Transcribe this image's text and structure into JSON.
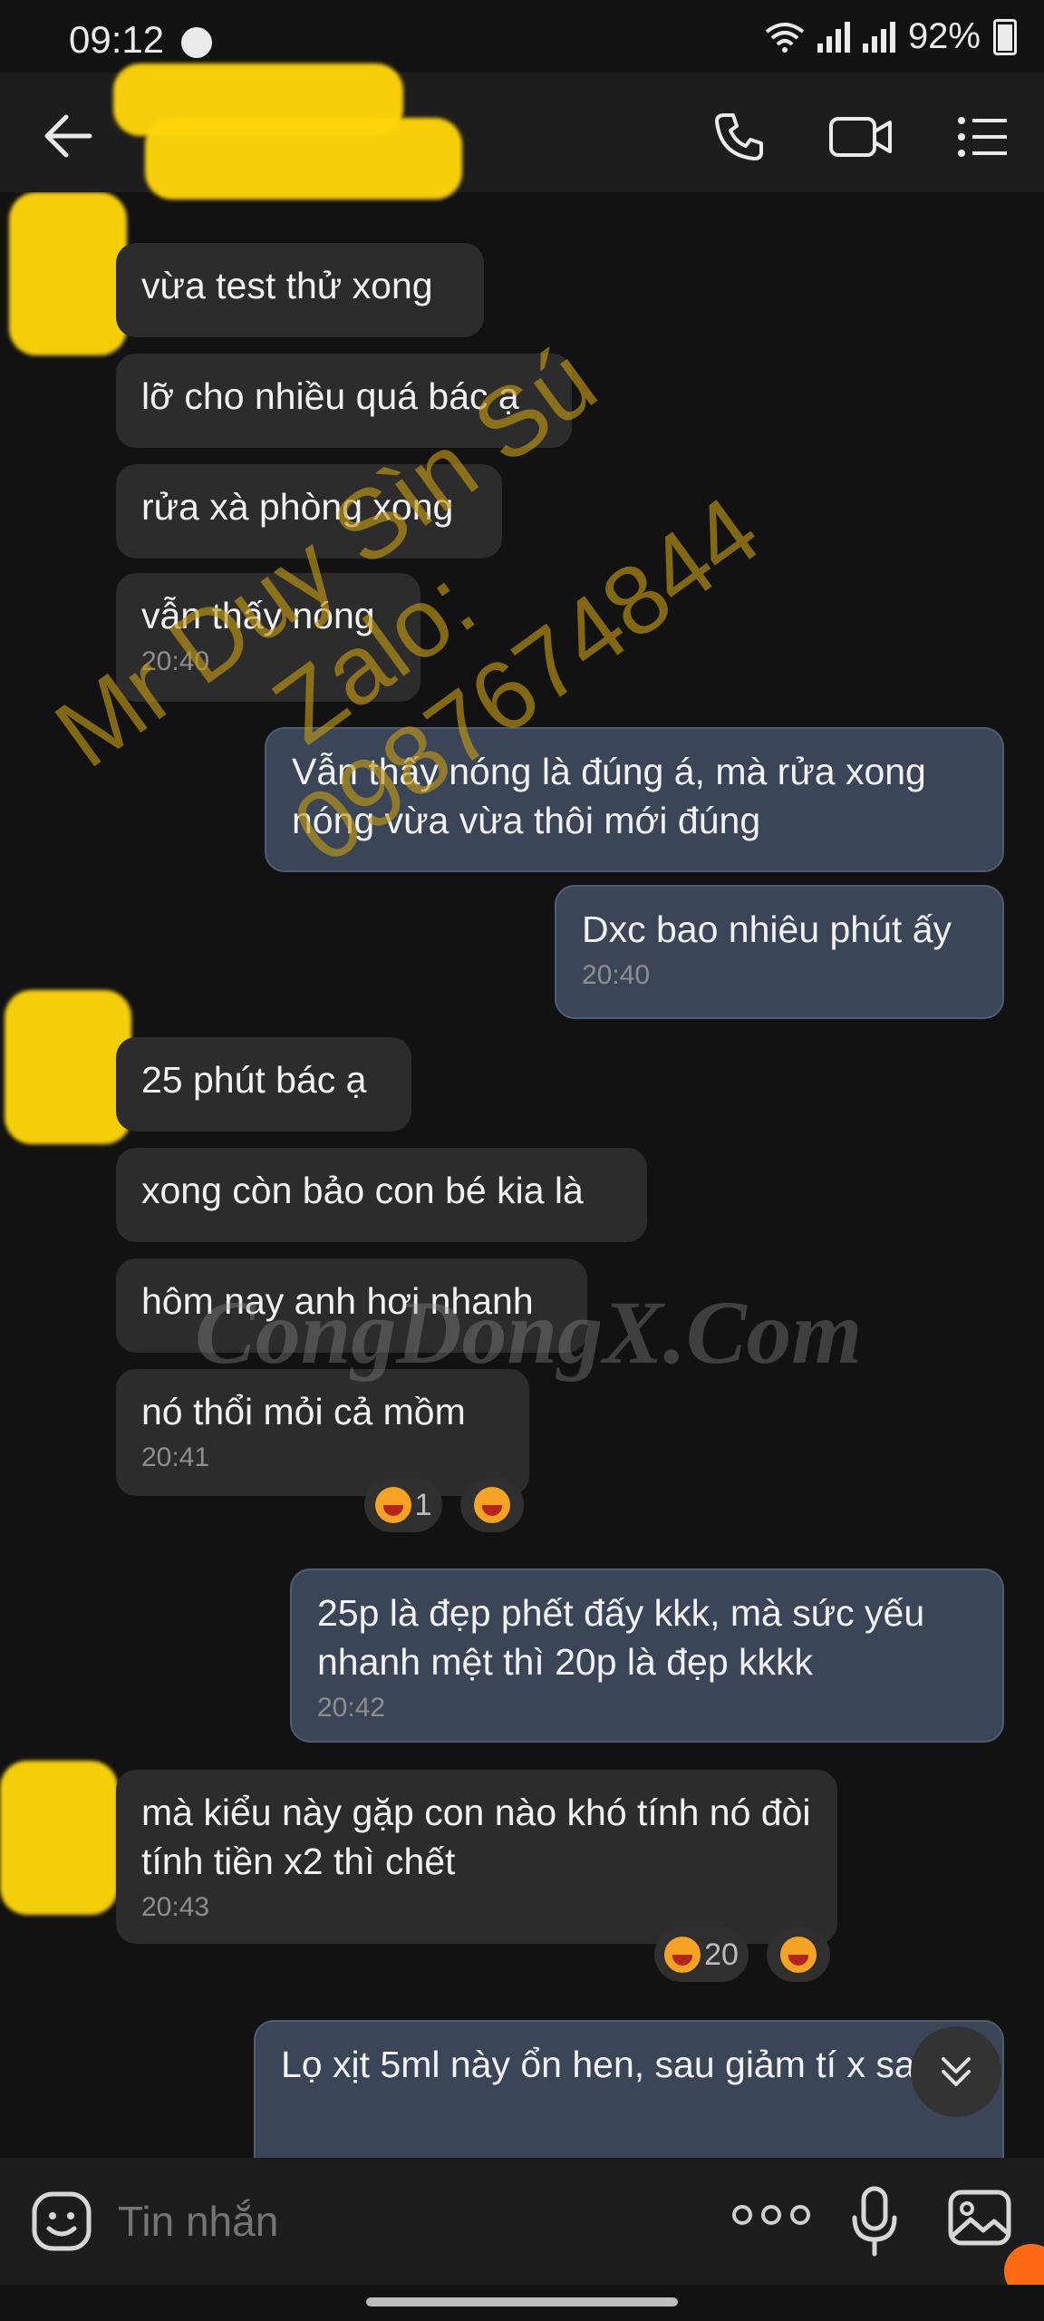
{
  "status": {
    "time": "09:12",
    "battery": "92%"
  },
  "header": {
    "contact_name": ""
  },
  "messages": [
    {
      "dir": "in",
      "text": "vừa test thử xong"
    },
    {
      "dir": "in",
      "text": "lỡ cho nhiều quá bác ạ"
    },
    {
      "dir": "in",
      "text": "rửa xà phòng xong"
    },
    {
      "dir": "in",
      "text": "vẫn thấy nóng",
      "time": "20:40"
    },
    {
      "dir": "out",
      "text": "Vẫn thấy nóng là đúng á, mà rửa xong nóng vừa vừa thôi mới đúng"
    },
    {
      "dir": "out",
      "text": "Dxc bao nhiêu phút ấy",
      "time": "20:40"
    },
    {
      "dir": "in",
      "text": "25 phút bác ạ"
    },
    {
      "dir": "in",
      "text": "xong còn bảo con bé kia là"
    },
    {
      "dir": "in",
      "text": "hôm nay anh hơi nhanh"
    },
    {
      "dir": "in",
      "text": "nó thổi mỏi cả mồm",
      "time": "20:41",
      "reaction_count": "1"
    },
    {
      "dir": "out",
      "text": "25p là đẹp phết đấy kkk, mà sức yếu nhanh mệt thì 20p là đẹp kkkk",
      "time": "20:42"
    },
    {
      "dir": "in",
      "text": "mà kiểu này gặp con nào khó tính nó đòi tính tiền x2 thì chết",
      "time": "20:43",
      "reaction_count": "20"
    },
    {
      "dir": "out",
      "text": "Lọ xịt 5ml này ổn hen, sau giảm tí x sao"
    }
  ],
  "watermark": {
    "line1": "Mr Duy Sìn Sú",
    "line2": "Zalo:",
    "line3": "0987674844",
    "site": "CongDongX.Com"
  },
  "composer": {
    "placeholder": "Tin nhắn"
  },
  "colors": {
    "incoming": "#2c2c2c",
    "outgoing": "#3a4658",
    "background": "#121212",
    "redaction": "#ffd60a"
  },
  "icons": [
    "back-arrow-icon",
    "phone-icon",
    "video-call-icon",
    "list-menu-icon",
    "sticker-icon",
    "more-icon",
    "microphone-icon",
    "image-icon",
    "chevron-double-down-icon"
  ]
}
